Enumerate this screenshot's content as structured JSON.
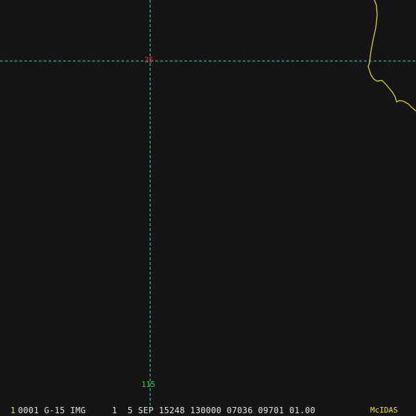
{
  "colors": {
    "background": "#151515",
    "graticule": "#3fd3d8",
    "coastline": "#f0e32a",
    "latitude_label": "#e2262c",
    "longitude_label": "#2fd84a",
    "status_text": "#e4e4e4",
    "frame_number": "#f0e32a",
    "brand": "#f0e32a"
  },
  "graticule": {
    "latitude_label": "25",
    "longitude_label": "115"
  },
  "status_bar": {
    "frame_number": "1",
    "text": "0001 G-15 IMG     1  5 SEP 15248 130000 07036 09701 01.00",
    "brand": "McIDAS"
  }
}
